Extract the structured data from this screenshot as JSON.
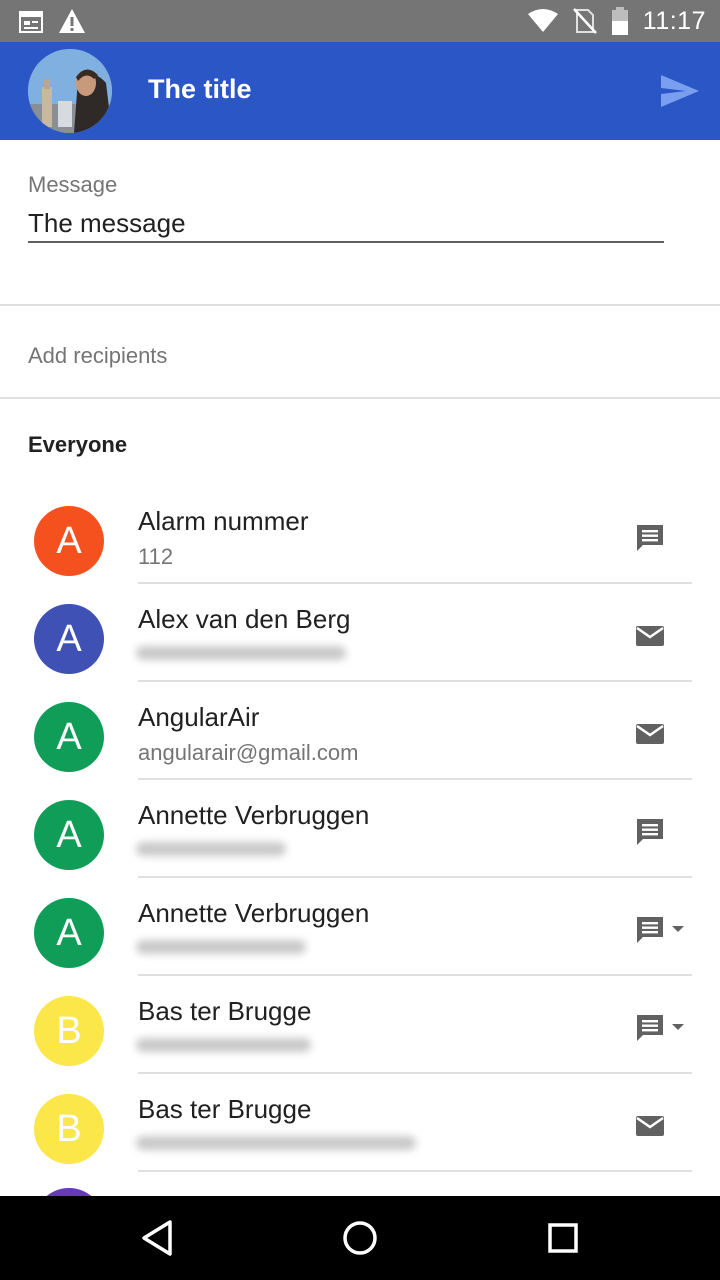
{
  "status_bar": {
    "time": "11:17",
    "icons": [
      "calendar-icon",
      "warning-icon",
      "wifi-icon",
      "no-sim-icon",
      "battery-icon"
    ]
  },
  "app_bar": {
    "title": "The title",
    "background": "#2b56c6",
    "send_icon": "send-icon"
  },
  "message": {
    "label": "Message",
    "value": "The message"
  },
  "recipients": {
    "placeholder": "Add recipients"
  },
  "section": {
    "title": "Everyone"
  },
  "contacts": [
    {
      "initial": "A",
      "name": "Alarm nummer",
      "subtitle": "112",
      "color": "#f4511e",
      "action_icon": "chat-icon",
      "has_dropdown": false
    },
    {
      "initial": "A",
      "name": "Alex van den Berg",
      "subtitle": "",
      "color": "#3f51b5",
      "action_icon": "email-icon",
      "has_dropdown": false
    },
    {
      "initial": "A",
      "name": "AngularAir",
      "subtitle": "angularair@gmail.com",
      "color": "#0f9d58",
      "action_icon": "email-icon",
      "has_dropdown": false
    },
    {
      "initial": "A",
      "name": "Annette Verbruggen",
      "subtitle": "",
      "color": "#0f9d58",
      "action_icon": "chat-icon",
      "has_dropdown": false
    },
    {
      "initial": "A",
      "name": "Annette Verbruggen",
      "subtitle": "",
      "color": "#0f9d58",
      "action_icon": "chat-icon",
      "has_dropdown": true
    },
    {
      "initial": "B",
      "name": "Bas ter Brugge",
      "subtitle": "",
      "color": "#fbe74a",
      "action_icon": "chat-icon",
      "has_dropdown": true
    },
    {
      "initial": "B",
      "name": "Bas ter Brugge",
      "subtitle": "",
      "color": "#fbe74a",
      "action_icon": "email-icon",
      "has_dropdown": false
    }
  ],
  "nav_bar": {
    "icons": [
      "back-icon",
      "home-icon",
      "recents-icon"
    ]
  }
}
